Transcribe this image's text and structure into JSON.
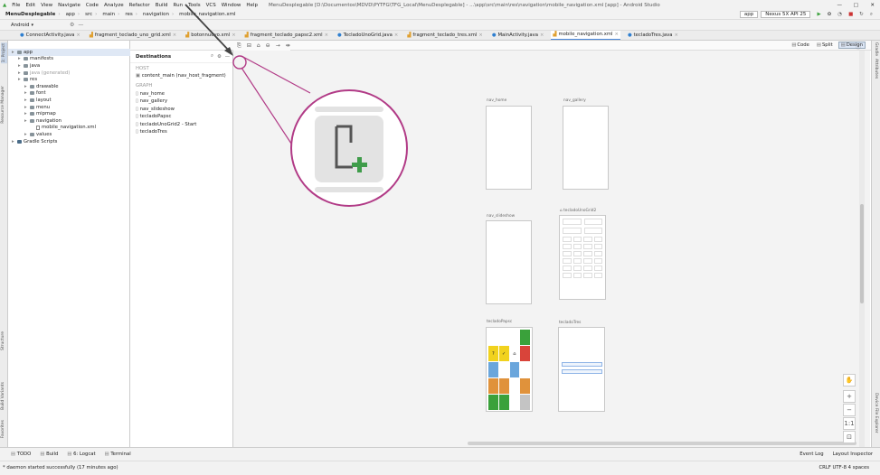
{
  "menubar": {
    "items": [
      "File",
      "Edit",
      "View",
      "Navigate",
      "Code",
      "Analyze",
      "Refactor",
      "Build",
      "Run",
      "Tools",
      "VCS",
      "Window",
      "Help"
    ],
    "title": "MenuDesplegable [D:\\Documentos\\MDVD\\PYTFG\\TFG_Local\\MenuDesplegable] - ...\\app\\src\\main\\res\\navigation\\mobile_navigation.xml [app] - Android Studio"
  },
  "breadcrumb": [
    "MenuDesplegable",
    "app",
    "src",
    "main",
    "res",
    "navigation",
    "mobile_navigation.xml"
  ],
  "toolbar": {
    "module": "app",
    "device": "Nexus 5X API 25"
  },
  "tabs": [
    "ConnectActivity.java",
    "fragment_teclado_uno_grid.xml",
    "botonnuevo.xml",
    "fragment_teclado_papsc2.xml",
    "TecladoUnoGrid.java",
    "fragment_teclado_tres.xml",
    "MainActivity.java",
    "mobile_navigation.xml",
    "tecladoTres.java"
  ],
  "view_modes": [
    "Code",
    "Split",
    "Design"
  ],
  "project": {
    "panel_label": "1: Project",
    "header": "Android",
    "items": [
      {
        "label": "app",
        "indent": 0,
        "kind": "folder"
      },
      {
        "label": "manifests",
        "indent": 1,
        "kind": "folder"
      },
      {
        "label": "java",
        "indent": 1,
        "kind": "folder"
      },
      {
        "label": "java (generated)",
        "indent": 1,
        "kind": "folder"
      },
      {
        "label": "res",
        "indent": 1,
        "kind": "folder"
      },
      {
        "label": "drawable",
        "indent": 2,
        "kind": "folder"
      },
      {
        "label": "font",
        "indent": 2,
        "kind": "folder"
      },
      {
        "label": "layout",
        "indent": 2,
        "kind": "folder"
      },
      {
        "label": "menu",
        "indent": 2,
        "kind": "folder"
      },
      {
        "label": "mipmap",
        "indent": 2,
        "kind": "folder"
      },
      {
        "label": "navigation",
        "indent": 2,
        "kind": "folder"
      },
      {
        "label": "mobile_navigation.xml",
        "indent": 3,
        "kind": "file"
      },
      {
        "label": "values",
        "indent": 2,
        "kind": "folder"
      },
      {
        "label": "Gradle Scripts",
        "indent": 0,
        "kind": "gradle"
      }
    ]
  },
  "destinations": {
    "title": "Destinations",
    "host_label": "HOST",
    "host": "content_main (nav_host_fragment)",
    "graph_label": "GRAPH",
    "items": [
      "nav_home",
      "nav_gallery",
      "nav_slideshow",
      "tecladoPapsc",
      "tecladoUnoGrid2 - Start",
      "tecladoTres"
    ]
  },
  "screens": {
    "nav_home": "nav_home",
    "nav_gallery": "nav_gallery",
    "nav_slideshow": "nav_slideshow",
    "tecladoUnoGrid2": "tecladoUnoGrid2",
    "tecladoPapsc": "tecladoPapsc",
    "tecladoTres": "tecladoTres"
  },
  "left_strip": {
    "captions": [
      "Resource Manager",
      "Structure",
      "Build Variants",
      "Favorites"
    ]
  },
  "right_strip": {
    "captions": [
      "Gradle",
      "Attributes",
      "Device File Explorer"
    ]
  },
  "statusbar": {
    "tabs": [
      "TODO",
      "Build",
      "6: Logcat",
      "Terminal"
    ],
    "right": [
      "Event Log",
      "Layout Inspector"
    ],
    "message": "* daemon started successfully (17 minutes ago)",
    "info": "CRLF  UTF-8  4 spaces"
  },
  "colors": {
    "accent": "#4a88da",
    "callout": "#b13a86",
    "key_green": "#3aa13b",
    "key_yellow": "#f1d21e",
    "key_red": "#d9443a",
    "key_blue": "#6aa6dc",
    "key_orange": "#e0923b",
    "key_gray": "#c4c4c4"
  }
}
